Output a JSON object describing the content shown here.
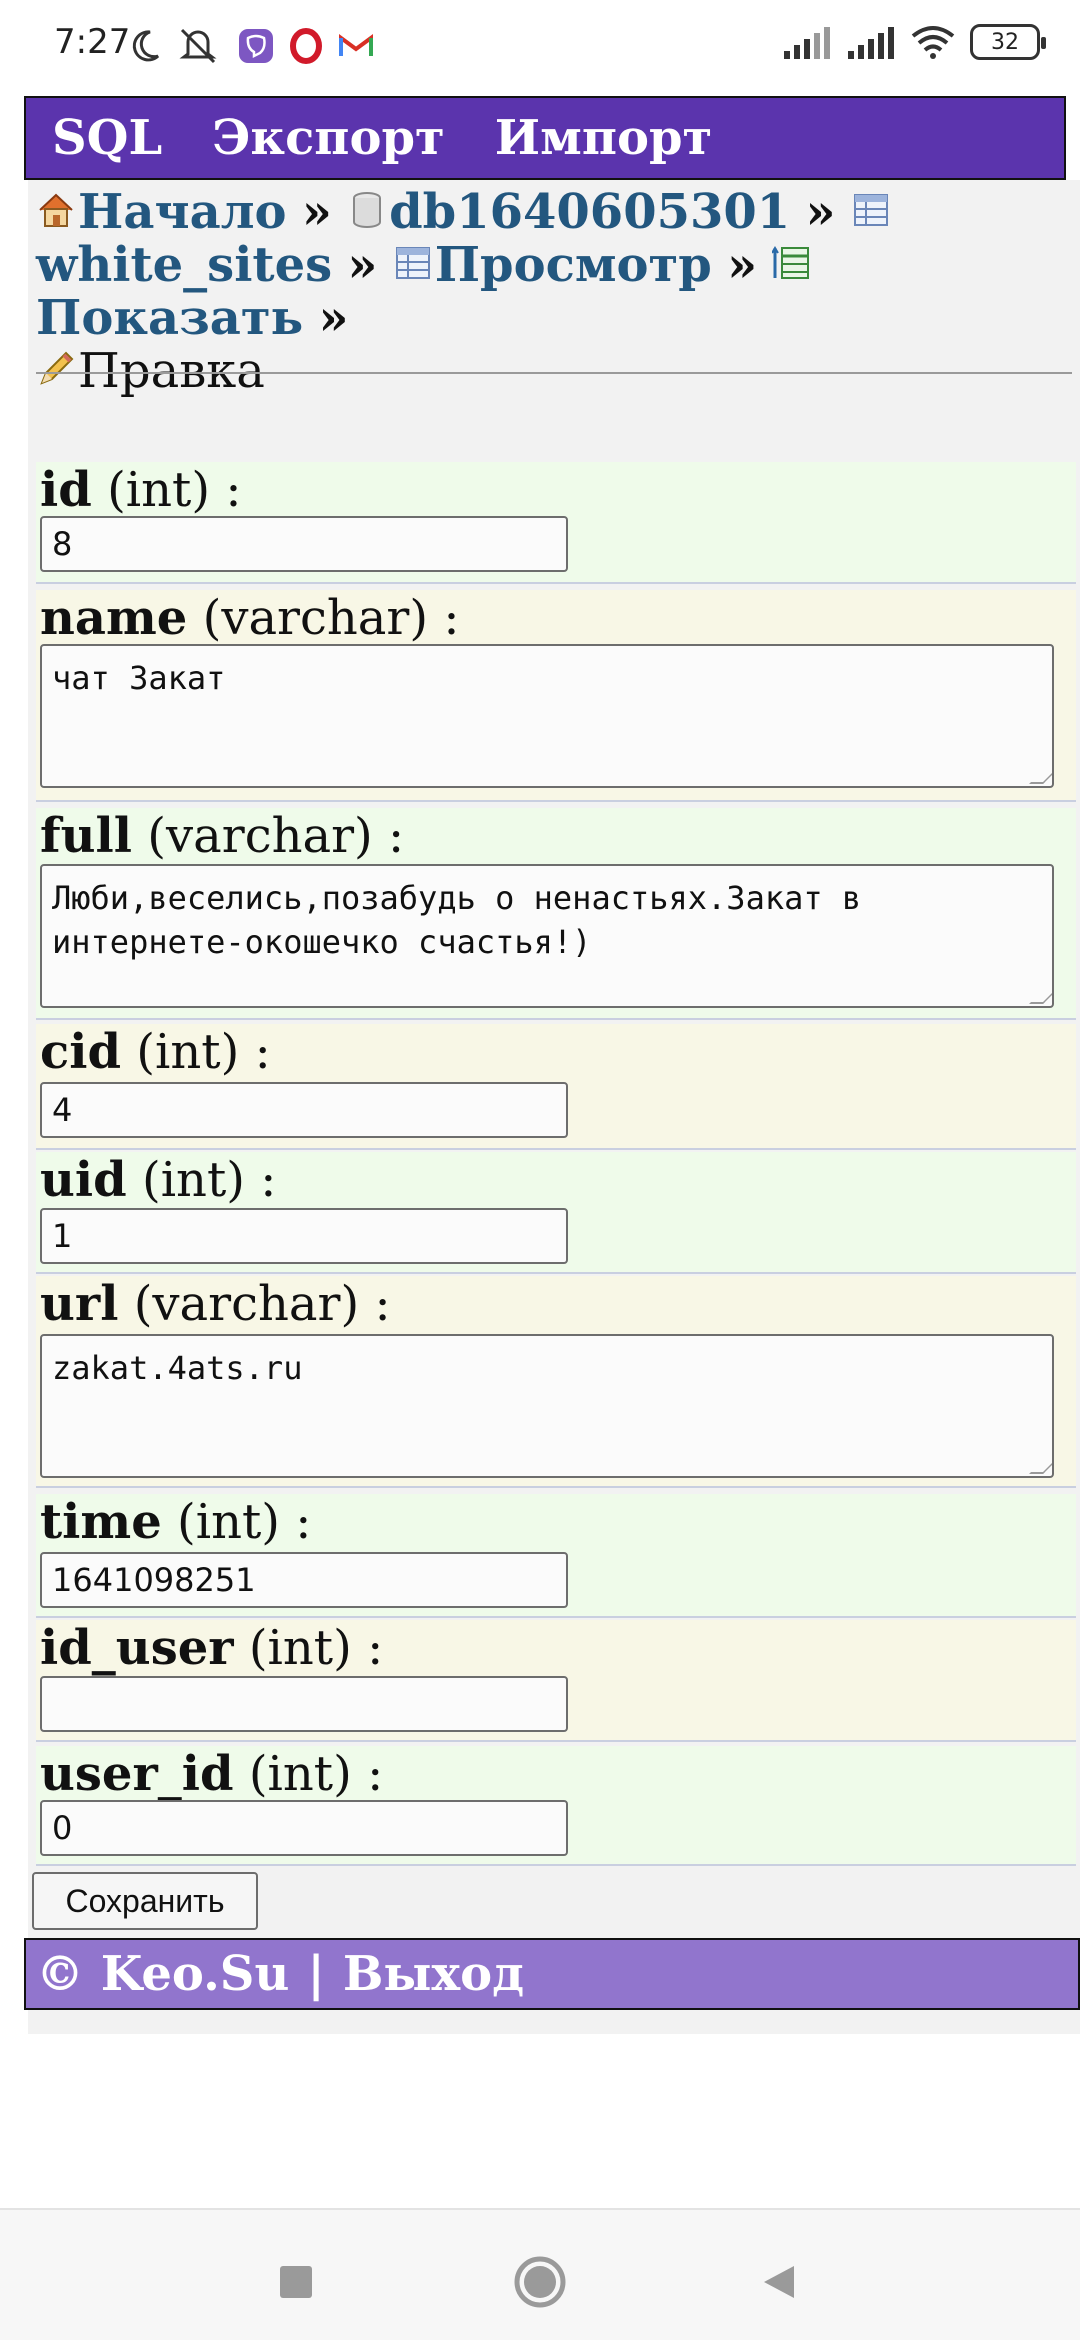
{
  "status_bar": {
    "time": "7:27",
    "battery": "32",
    "icons": [
      "moon-icon",
      "mute-icon",
      "viber-icon",
      "opera-icon",
      "gmail-icon",
      "signal-icon",
      "signal-icon",
      "wifi-icon",
      "battery-icon"
    ]
  },
  "nav": {
    "sql": "SQL",
    "export": "Экспорт",
    "import": "Импорт"
  },
  "breadcrumb": {
    "home": "Начало",
    "db": "db1640605301",
    "table": "white_sites",
    "browse": "Просмотр",
    "show": "Показать",
    "edit": "Правка",
    "sep": "»"
  },
  "fields": [
    {
      "name": "id",
      "type": "(int) :",
      "value": "8"
    },
    {
      "name": "name",
      "type": "(varchar) :",
      "value": "чат Закат"
    },
    {
      "name": "full",
      "type": "(varchar) :",
      "value": "Люби,веселись,позабудь о ненастьях.Закат в интернете-окошечко счастья!)"
    },
    {
      "name": "cid",
      "type": "(int) :",
      "value": "4"
    },
    {
      "name": "uid",
      "type": "(int) :",
      "value": "1"
    },
    {
      "name": "url",
      "type": "(varchar) :",
      "value": "zakat.4ats.ru"
    },
    {
      "name": "time",
      "type": "(int) :",
      "value": "1641098251"
    },
    {
      "name": "id_user",
      "type": "(int) :",
      "value": ""
    },
    {
      "name": "user_id",
      "type": "(int) :",
      "value": "0"
    }
  ],
  "save_label": "Сохранить",
  "footer": {
    "copyright": "© Keo.Su",
    "divider": "|",
    "logout": "Выход"
  },
  "colors": {
    "nav_bg": "#5b34ad",
    "footer_bg": "#9175cd",
    "link": "#23577f",
    "row_green": "#effbea",
    "row_yellow": "#f8f7e6"
  }
}
